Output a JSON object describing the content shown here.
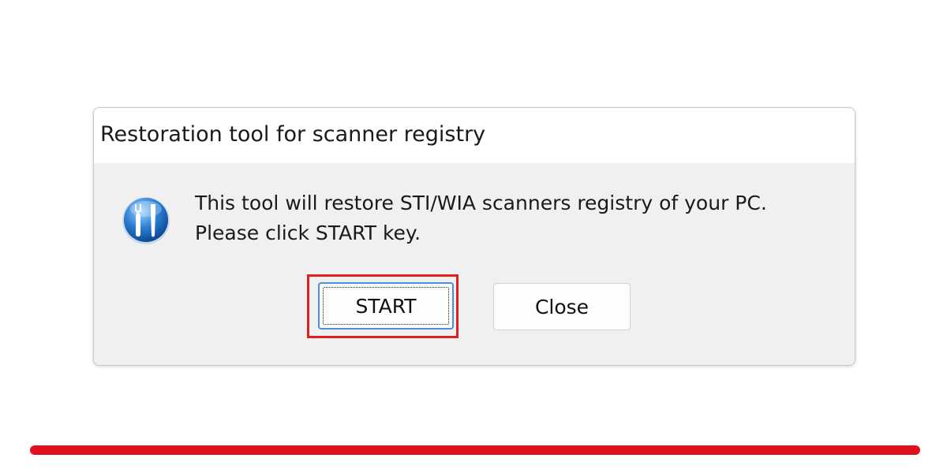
{
  "dialog": {
    "title": "Restoration tool for scanner registry",
    "icon": "tools-info-icon",
    "message_line1": "This tool will restore STI/WIA scanners registry of your PC.",
    "message_line2": "Please click START key.",
    "start_label": "START",
    "close_label": "Close"
  },
  "colors": {
    "highlight": "#e02020",
    "accent_bar": "#e0101e",
    "focus_border": "#4a8fd8"
  }
}
